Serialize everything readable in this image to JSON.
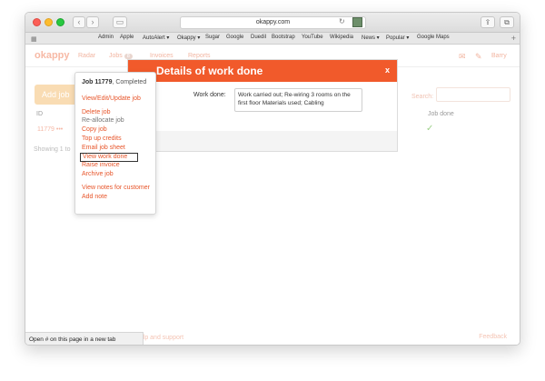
{
  "browser": {
    "url": "okappy.com",
    "bookmarks": [
      "Admin",
      "Apple",
      "AutoAlert ▾",
      "Okappy ▾",
      "Sugar",
      "Google",
      "Duedil",
      "Bootstrap",
      "YouTube",
      "Wikipedia",
      "News ▾",
      "Popular ▾",
      "Google Maps"
    ]
  },
  "app": {
    "logo": "okappy",
    "nav": {
      "radar": "Radar",
      "jobs": "Jobs",
      "jobs_badge": "8",
      "invoices": "Invoices",
      "reports": "Reports",
      "user": "Barry"
    },
    "add_job": "Add job",
    "table": {
      "col_id": "ID",
      "col_job_done": "Job done",
      "row_id": "11779",
      "row_dots": "•••"
    },
    "showing": "Showing 1 to",
    "search_label": "Search:",
    "help": "Help and support",
    "feedback": "Feedback"
  },
  "modal": {
    "title": "Details of work done",
    "close": "x",
    "work_done_label": "Work done:",
    "work_done_value": "Work carried out; Re-wiring 3 rooms on the first floor Materials used; Cabling"
  },
  "menu": {
    "job_number": "Job 11779",
    "job_status": ", Completed",
    "items": [
      {
        "label": "View/Edit/Update job"
      },
      {
        "label": "Delete job"
      },
      {
        "label": "Re-allocate job"
      },
      {
        "label": "Copy job"
      },
      {
        "label": "Top up credits"
      },
      {
        "label": "Email job sheet"
      },
      {
        "label": "View work done"
      },
      {
        "label": "Raise invoice"
      },
      {
        "label": "Archive job"
      },
      {
        "label": "View notes for customer"
      },
      {
        "label": "Add note"
      }
    ]
  },
  "statusbar": "Open # on this page in a new tab"
}
